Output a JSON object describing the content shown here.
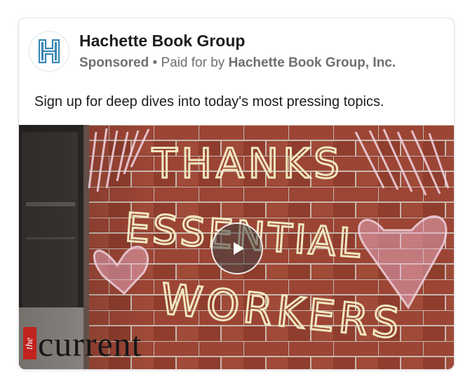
{
  "ad": {
    "advertiser": "Hachette Book Group",
    "sponsored_label": "Sponsored",
    "separator": "•",
    "paid_for_by": "Paid for by",
    "payer": "Hachette Book Group, Inc.",
    "body": "Sign up for deep dives into today's most pressing topics.",
    "logo_icon": "hachette-h-logo-icon",
    "brand_color": "#3a87b2"
  },
  "media": {
    "chalk_text": [
      "THANKS",
      "ESSENTIAL",
      "WORKERS"
    ],
    "watermark_the": "the",
    "watermark_current": "current",
    "play_icon": "play-icon"
  }
}
